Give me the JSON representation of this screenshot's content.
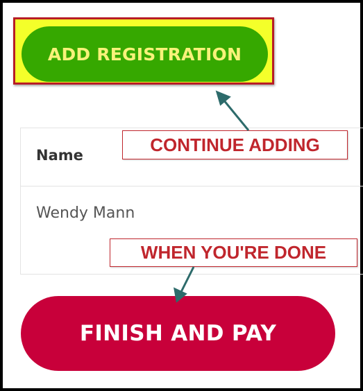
{
  "buttons": {
    "add_registration": "ADD REGISTRATION",
    "finish_and_pay": "FINISH AND PAY"
  },
  "table": {
    "columns": [
      "Name"
    ],
    "rows": [
      {
        "name": "Wendy Mann"
      }
    ]
  },
  "annotations": {
    "continue_adding": "CONTINUE ADDING",
    "when_done": "WHEN YOU'RE DONE"
  },
  "colors": {
    "add_button_bg": "#36a800",
    "add_button_text": "#f8f27a",
    "highlight_fill": "#f4ff2a",
    "highlight_border": "#b81d25",
    "finish_button_bg": "#c8003a",
    "callout_text": "#c0262d",
    "arrow": "#2d6b6b"
  }
}
